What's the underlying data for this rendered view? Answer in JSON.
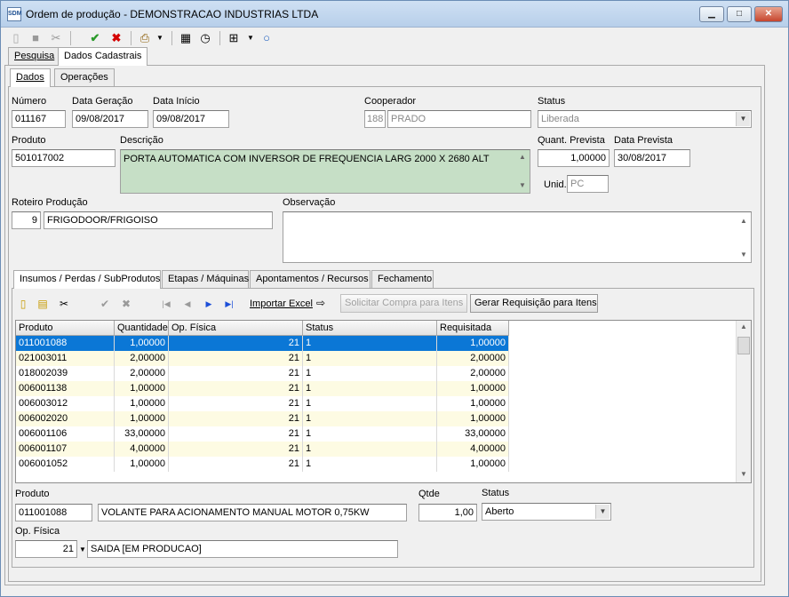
{
  "window": {
    "title": "Ordem de produção - DEMONSTRACAO INDUSTRIAS LTDA",
    "app_icon": "SDM",
    "controls": {
      "minimize": "▁",
      "maximize": "□",
      "close": "✕"
    }
  },
  "toolbar": {
    "icons": [
      "new-doc-icon",
      "save-icon",
      "cut-icon",
      "confirm-icon",
      "cancel-icon",
      "print-icon",
      "calculator-icon",
      "clock-icon",
      "network-icon",
      "circle-icon"
    ]
  },
  "outer_tabs": [
    "Pesquisa",
    "Dados Cadastrais"
  ],
  "inner_tabs": [
    "Dados",
    "Operações"
  ],
  "form": {
    "numero": {
      "label": "Número",
      "value": "011167"
    },
    "data_geracao": {
      "label": "Data Geração",
      "value": "09/08/2017"
    },
    "data_inicio": {
      "label": "Data Início",
      "value": "09/08/2017"
    },
    "cooperador": {
      "label": "Cooperador",
      "code": "188",
      "name": "PRADO"
    },
    "status": {
      "label": "Status",
      "value": "Liberada"
    },
    "produto": {
      "label": "Produto",
      "value": "501017002"
    },
    "descricao": {
      "label": "Descrição",
      "value": "PORTA AUTOMATICA COM INVERSOR DE FREQUENCIA  LARG 2000 X 2680 ALT"
    },
    "quant_prevista": {
      "label": "Quant. Prevista",
      "value": "1,00000"
    },
    "data_prevista": {
      "label": "Data Prevista",
      "value": "30/08/2017"
    },
    "unid": {
      "label": "Unid.",
      "value": "PC"
    },
    "roteiro": {
      "label": "Roteiro Produção",
      "code": "9",
      "name": "FRIGODOOR/FRIGOISO"
    },
    "observacao": {
      "label": "Observação",
      "value": ""
    }
  },
  "detail_tabs": [
    "Insumos / Perdas / SubProdutos",
    "Etapas / Máquinas",
    "Apontamentos / Recursos",
    "Fechamento"
  ],
  "sub_toolbar": {
    "import_excel": "Importar Excel",
    "solicitar": "Solicitar Compra para Itens",
    "gerar": "Gerar Requisição para Itens"
  },
  "grid": {
    "columns": [
      "Produto",
      "Quantidade",
      "Op. Física",
      "Status",
      "Requisitada"
    ],
    "rows": [
      [
        "011001088",
        "1,00000",
        "21",
        "1",
        "1,00000"
      ],
      [
        "021003011",
        "2,00000",
        "21",
        "1",
        "2,00000"
      ],
      [
        "018002039",
        "2,00000",
        "21",
        "1",
        "2,00000"
      ],
      [
        "006001138",
        "1,00000",
        "21",
        "1",
        "1,00000"
      ],
      [
        "006003012",
        "1,00000",
        "21",
        "1",
        "1,00000"
      ],
      [
        "006002020",
        "1,00000",
        "21",
        "1",
        "1,00000"
      ],
      [
        "006001106",
        "33,00000",
        "21",
        "1",
        "33,00000"
      ],
      [
        "006001107",
        "4,00000",
        "21",
        "1",
        "4,00000"
      ],
      [
        "006001052",
        "1,00000",
        "21",
        "1",
        "1,00000"
      ]
    ]
  },
  "detail": {
    "produto": {
      "label": "Produto",
      "code": "011001088",
      "desc": "VOLANTE PARA ACIONAMENTO MANUAL MOTOR 0,75KW"
    },
    "qtde": {
      "label": "Qtde",
      "value": "1,00"
    },
    "status": {
      "label": "Status",
      "value": "Aberto"
    },
    "op_fisica": {
      "label": "Op. Física",
      "code": "21",
      "desc": "SAIDA [EM PRODUCAO]"
    }
  },
  "colors": {
    "selected_row": "#0b77d6",
    "alt_row": "#fdfbe3",
    "description_bg": "#c6dfc6"
  }
}
